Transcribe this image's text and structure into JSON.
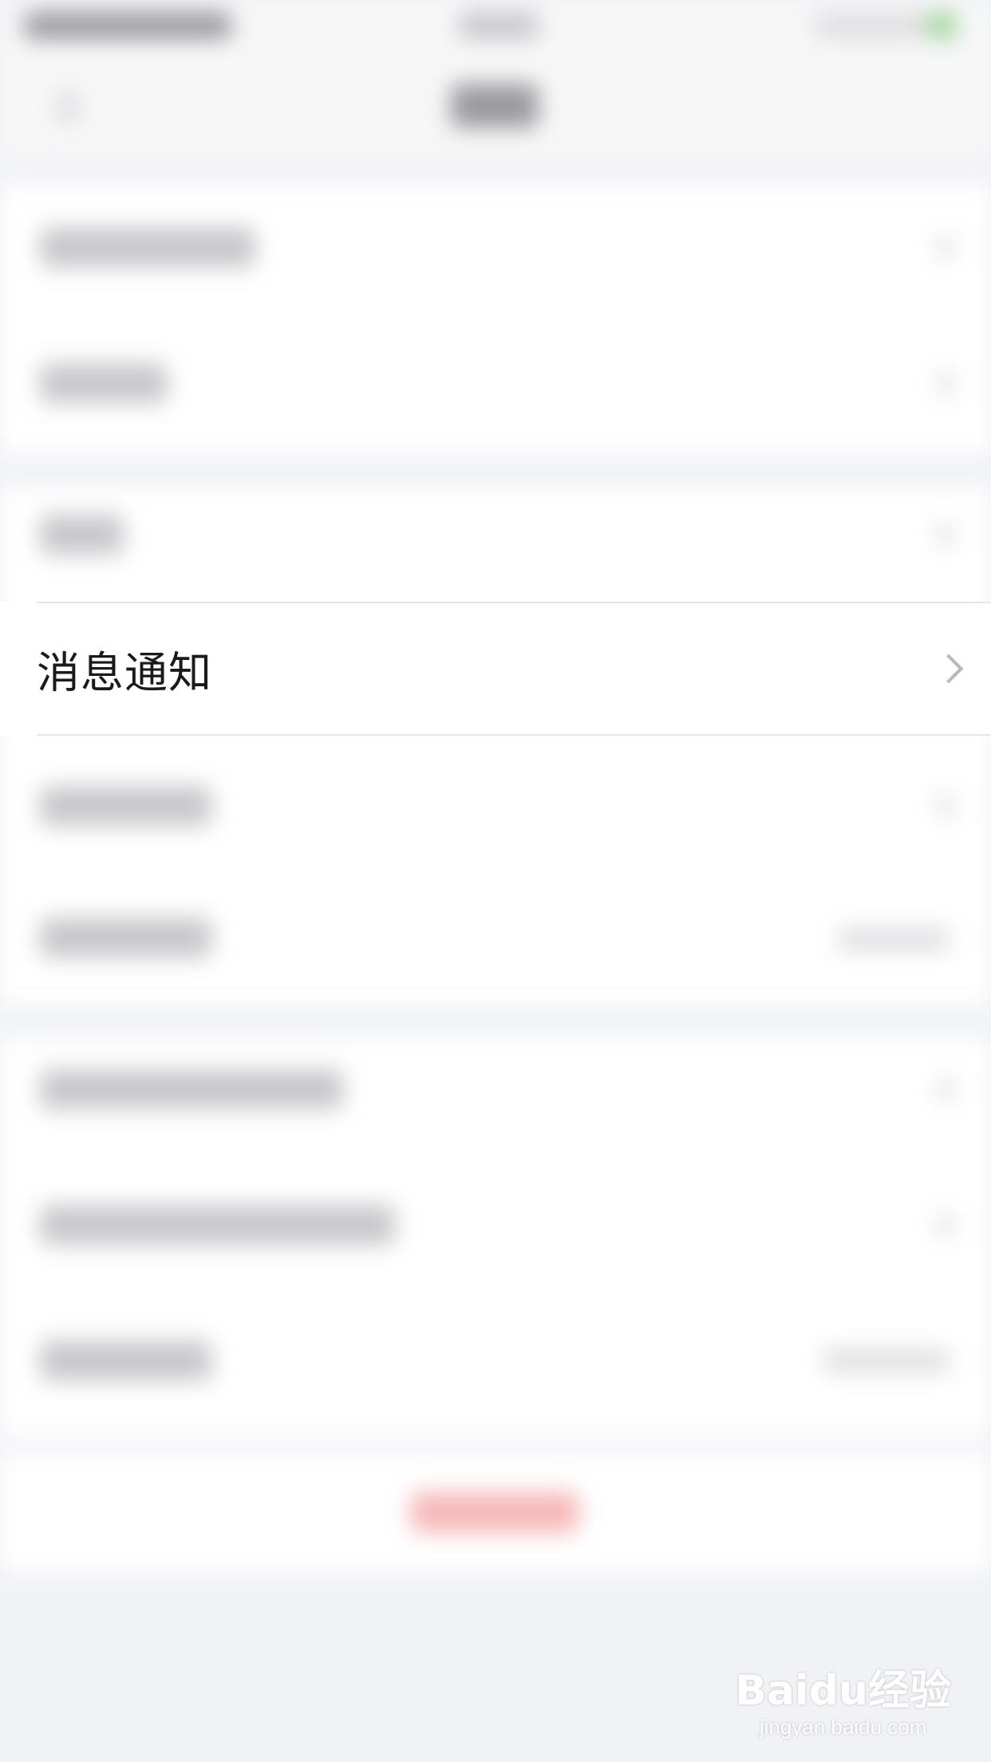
{
  "settings": {
    "notification_item": {
      "label": "消息通知"
    }
  },
  "watermark": {
    "logo": "Baidu经验",
    "url": "jingyan.baidu.com"
  }
}
